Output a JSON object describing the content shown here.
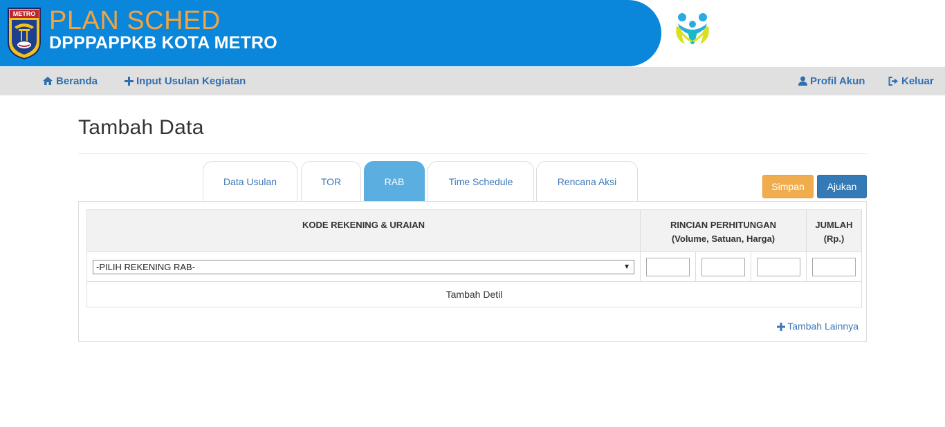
{
  "header": {
    "seal_text": "METRO",
    "title": "PLAN SCHED",
    "subtitle": "DPPPAPPKB KOTA METRO"
  },
  "nav": {
    "home": "Beranda",
    "input": "Input Usulan Kegiatan",
    "profile": "Profil Akun",
    "logout": "Keluar"
  },
  "page": {
    "title": "Tambah Data"
  },
  "tabs": [
    {
      "label": "Data Usulan"
    },
    {
      "label": "TOR"
    },
    {
      "label": "RAB"
    },
    {
      "label": "Time Schedule"
    },
    {
      "label": "Rencana Aksi"
    }
  ],
  "active_tab": "RAB",
  "actions": {
    "save": "Simpan",
    "submit": "Ajukan"
  },
  "table": {
    "col_account": "KODE REKENING & URAIAN",
    "col_calc_line1": "RINCIAN PERHITUNGAN",
    "col_calc_line2": "(Volume, Satuan, Harga)",
    "col_total_line1": "JUMLAH",
    "col_total_line2": "(Rp.)",
    "select_value": "-PILIH REKENING RAB-",
    "add_detail": "Tambah Detil"
  },
  "more_link": "Tambah Lainnya",
  "colors": {
    "header_blue": "#0a86da",
    "title_orange": "#f4a340",
    "tab_active": "#5aaee0",
    "btn_warning": "#f0ad4e",
    "btn_primary": "#337ab7"
  }
}
